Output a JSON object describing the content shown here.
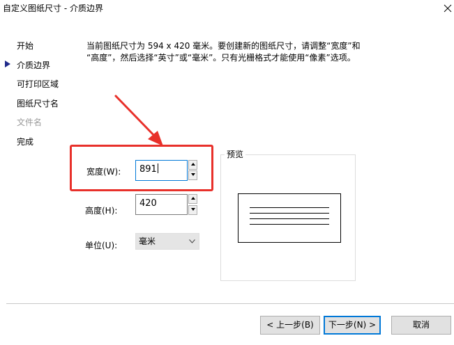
{
  "window": {
    "title": "自定义图纸尺寸 - 介质边界"
  },
  "sidebar": {
    "items": [
      {
        "label": "开始",
        "state": "enabled"
      },
      {
        "label": "介质边界",
        "state": "current"
      },
      {
        "label": "可打印区域",
        "state": "enabled"
      },
      {
        "label": "图纸尺寸名",
        "state": "enabled"
      },
      {
        "label": "文件名",
        "state": "disabled"
      },
      {
        "label": "完成",
        "state": "enabled"
      }
    ]
  },
  "description": {
    "line1": "当前图纸尺寸为 594 x 420 毫米。要创建新的图纸尺寸，请调整“宽度”和",
    "line2": "“高度”，然后选择“英寸”或“毫米”。只有光栅格式才能使用“像素”选项。"
  },
  "fields": {
    "width_label": "宽度(W):",
    "width_value": "891",
    "height_label": "高度(H):",
    "height_value": "420",
    "unit_label": "单位(U):",
    "unit_value": "毫米"
  },
  "preview": {
    "label": "预览"
  },
  "buttons": {
    "back": "< 上一步(B)",
    "next": "下一步(N) >",
    "cancel": "取消"
  },
  "colors": {
    "annotation_red": "#e8302a",
    "focus_blue": "#0078d7"
  },
  "icons": {
    "close": "close-icon",
    "current_step": "triangle-right-icon",
    "spin_up": "spin-up-icon",
    "spin_down": "spin-down-icon",
    "dropdown": "chevron-down-icon"
  }
}
